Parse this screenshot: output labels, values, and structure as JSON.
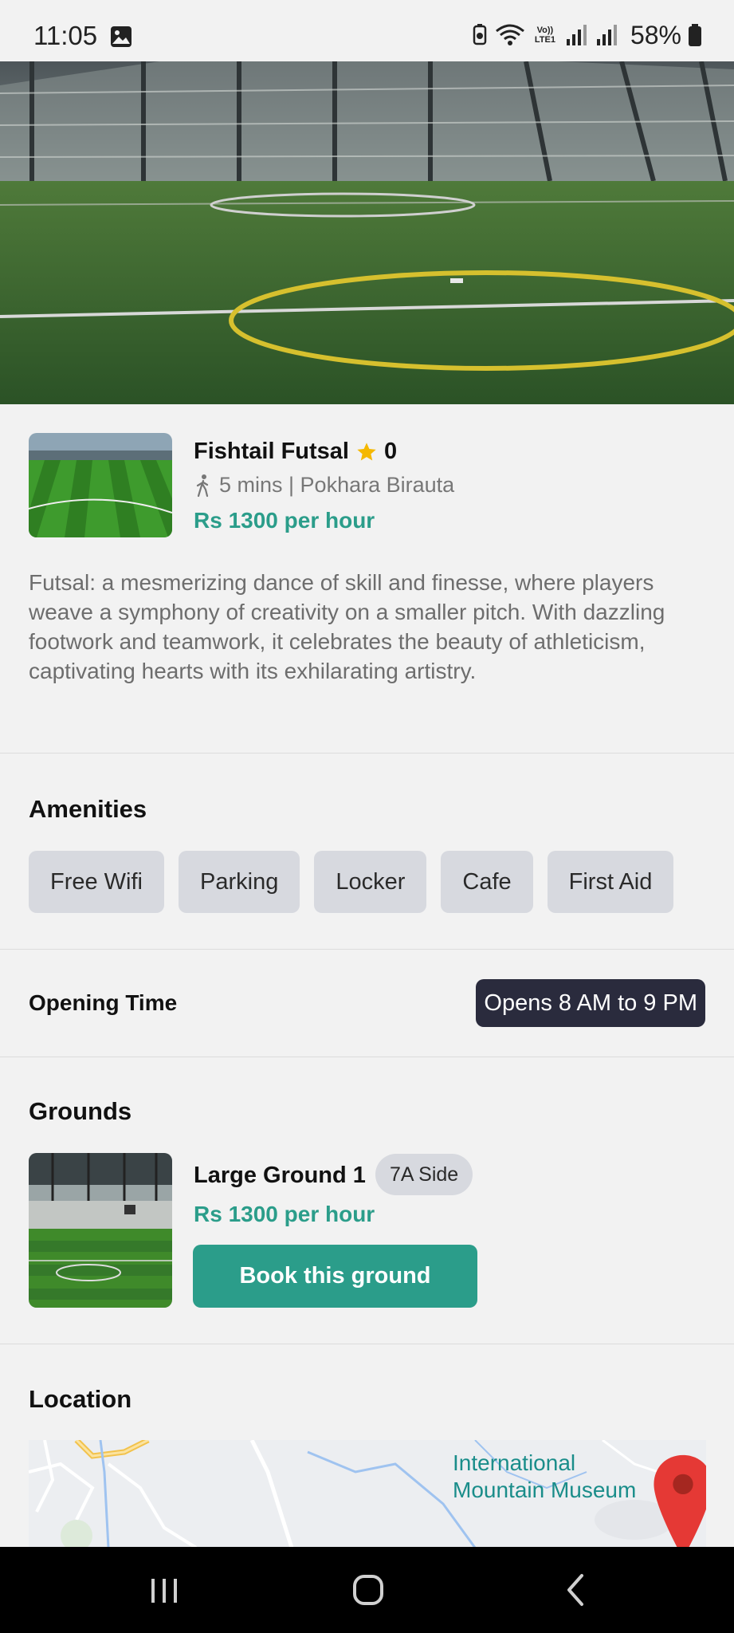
{
  "status_bar": {
    "time": "11:05",
    "network_label": "Vo)) LTE1",
    "battery": "58%"
  },
  "venue": {
    "name": "Fishtail Futsal",
    "rating": "0",
    "meta": "5 mins | Pokhara Birauta",
    "price": "Rs 1300 per hour",
    "description": "Futsal: a mesmerizing dance of skill and finesse, where players weave a symphony of creativity on a smaller pitch. With dazzling footwork and teamwork, it celebrates the beauty of athleticism, captivating hearts with its exhilarating artistry."
  },
  "amenities": {
    "title": "Amenities",
    "items": [
      "Free Wifi",
      "Parking",
      "Locker",
      "Cafe",
      "First Aid"
    ]
  },
  "opening": {
    "label": "Opening Time",
    "value": "Opens 8 AM to 9 PM"
  },
  "grounds": {
    "title": "Grounds",
    "items": [
      {
        "name": "Large Ground 1",
        "type": "7A Side",
        "price": "Rs 1300 per hour",
        "button": "Book this ground"
      }
    ]
  },
  "location": {
    "title": "Location",
    "map_label_line1": "International",
    "map_label_line2": "Mountain Museum"
  },
  "colors": {
    "accent": "#2b9d8a",
    "badge_dark": "#2a2b3d",
    "chip": "#d7d9df",
    "star": "#f5b800",
    "pin": "#e53935"
  },
  "icons": {
    "status": [
      "gallery-icon",
      "battery-saver-icon",
      "wifi-icon",
      "signal-icon",
      "battery-icon"
    ],
    "rating": "star-icon",
    "distance": "walk-icon",
    "map": "map-pin-icon",
    "nav": [
      "recent-apps-icon",
      "home-icon",
      "back-icon"
    ]
  }
}
